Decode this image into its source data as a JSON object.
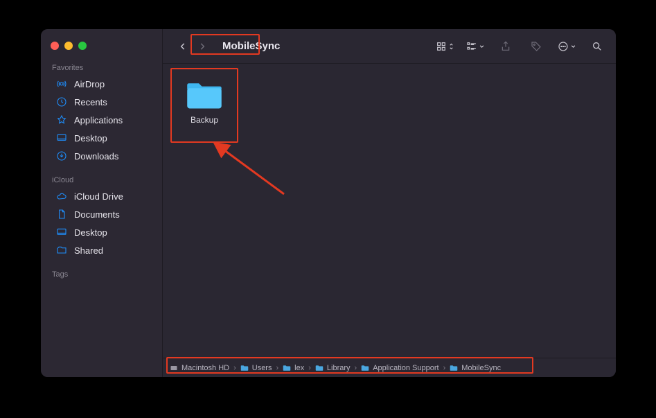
{
  "window": {
    "title": "MobileSync"
  },
  "sidebar": {
    "sections": [
      {
        "label": "Favorites",
        "items": [
          {
            "icon": "airdrop",
            "label": "AirDrop"
          },
          {
            "icon": "recents",
            "label": "Recents"
          },
          {
            "icon": "apps",
            "label": "Applications"
          },
          {
            "icon": "desktop",
            "label": "Desktop"
          },
          {
            "icon": "downloads",
            "label": "Downloads"
          }
        ]
      },
      {
        "label": "iCloud",
        "items": [
          {
            "icon": "icloud",
            "label": "iCloud Drive"
          },
          {
            "icon": "documents",
            "label": "Documents"
          },
          {
            "icon": "desktop",
            "label": "Desktop"
          },
          {
            "icon": "shared",
            "label": "Shared"
          }
        ]
      },
      {
        "label": "Tags",
        "items": []
      }
    ]
  },
  "content": {
    "items": [
      {
        "type": "folder",
        "label": "Backup"
      }
    ]
  },
  "pathbar": {
    "crumbs": [
      {
        "icon": "disk",
        "label": "Macintosh HD"
      },
      {
        "icon": "folder",
        "label": "Users"
      },
      {
        "icon": "folder",
        "label": "lex"
      },
      {
        "icon": "folder",
        "label": "Library"
      },
      {
        "icon": "folder",
        "label": "Application Support"
      },
      {
        "icon": "folder",
        "label": "MobileSync"
      }
    ]
  }
}
